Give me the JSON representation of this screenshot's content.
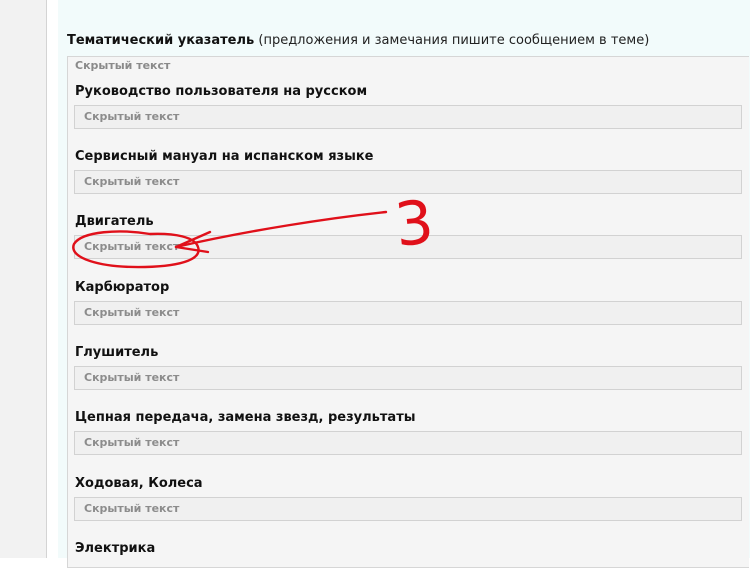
{
  "page": {
    "title": "Тематический указатель",
    "title_note": " (предложения и замечания пишите сообщением в теме)",
    "outer_spoiler_label": "Скрытый текст"
  },
  "sections": [
    {
      "heading": "Руководство пользователя на русском",
      "spoiler_label": "Скрытый текст"
    },
    {
      "heading": "Сервисный мануал на испанском языке",
      "spoiler_label": "Скрытый текст"
    },
    {
      "heading": "Двигатель",
      "spoiler_label": "Скрытый текст"
    },
    {
      "heading": "Карбюратор",
      "spoiler_label": "Скрытый текст"
    },
    {
      "heading": "Глушитель",
      "spoiler_label": "Скрытый текст"
    },
    {
      "heading": "Цепная передача, замена звезд, результаты",
      "spoiler_label": "Скрытый текст"
    },
    {
      "heading": "Ходовая, Колеса",
      "spoiler_label": "Скрытый текст"
    },
    {
      "heading": "Электрика"
    }
  ],
  "annotation": {
    "number": "3",
    "color": "#e0101a"
  }
}
